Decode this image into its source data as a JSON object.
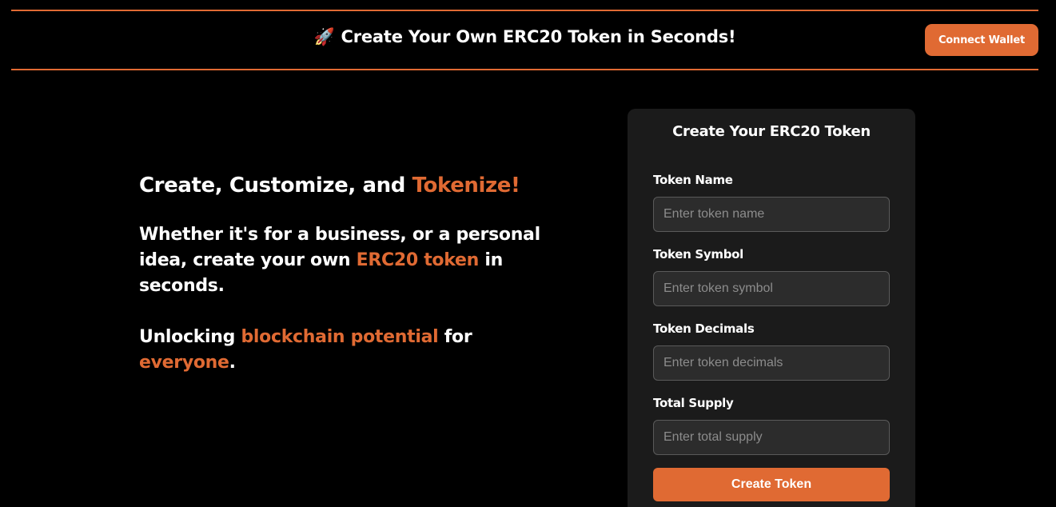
{
  "header": {
    "rocket": "🚀",
    "title": "Create Your Own ERC20 Token in Seconds!",
    "connect_wallet_label": "Connect Wallet"
  },
  "hero": {
    "headline_prefix": "Create, Customize, and ",
    "headline_accent": "Tokenize!",
    "p1_prefix": "Whether it's for a business, or a personal idea, create your own ",
    "p1_accent": "ERC20 token",
    "p1_suffix": " in seconds.",
    "p2_prefix": "Unlocking ",
    "p2_accent1": "blockchain potential",
    "p2_middle": " for ",
    "p2_accent2": "everyone",
    "p2_suffix": "."
  },
  "form": {
    "title": "Create Your ERC20 Token",
    "fields": [
      {
        "label": "Token Name",
        "placeholder": "Enter token name",
        "value": ""
      },
      {
        "label": "Token Symbol",
        "placeholder": "Enter token symbol",
        "value": ""
      },
      {
        "label": "Token Decimals",
        "placeholder": "Enter token decimals",
        "value": ""
      },
      {
        "label": "Total Supply",
        "placeholder": "Enter total supply",
        "value": ""
      }
    ],
    "submit_label": "Create Token"
  },
  "colors": {
    "accent": "#e06a33",
    "background": "#000000",
    "card": "#1b1b1b"
  }
}
